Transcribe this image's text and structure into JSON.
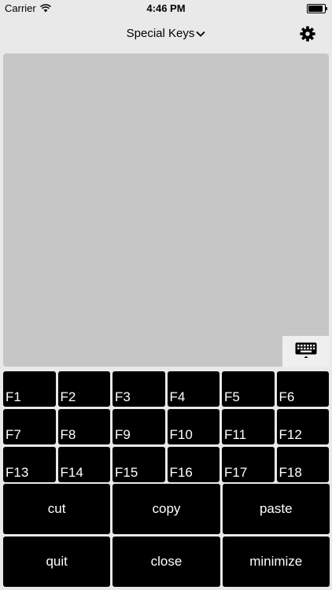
{
  "status": {
    "carrier": "Carrier",
    "time": "4:46 PM",
    "icons": [
      "wifi-icon",
      "battery-icon"
    ]
  },
  "nav": {
    "title": "Special Keys",
    "title_icon": "chevron-down-icon",
    "settings_icon": "gear-icon"
  },
  "keyboard_toggle_icon": "keyboard-icon",
  "function_keys": [
    "F1",
    "F2",
    "F3",
    "F4",
    "F5",
    "F6",
    "F7",
    "F8",
    "F9",
    "F10",
    "F11",
    "F12",
    "F13",
    "F14",
    "F15",
    "F16",
    "F17",
    "F18"
  ],
  "actions": [
    "cut",
    "copy",
    "paste",
    "quit",
    "close",
    "minimize"
  ],
  "colors": {
    "background": "#e9e9e9",
    "trackpad": "#c6c6c6",
    "key": "#000000",
    "key_text": "#ffffff"
  }
}
